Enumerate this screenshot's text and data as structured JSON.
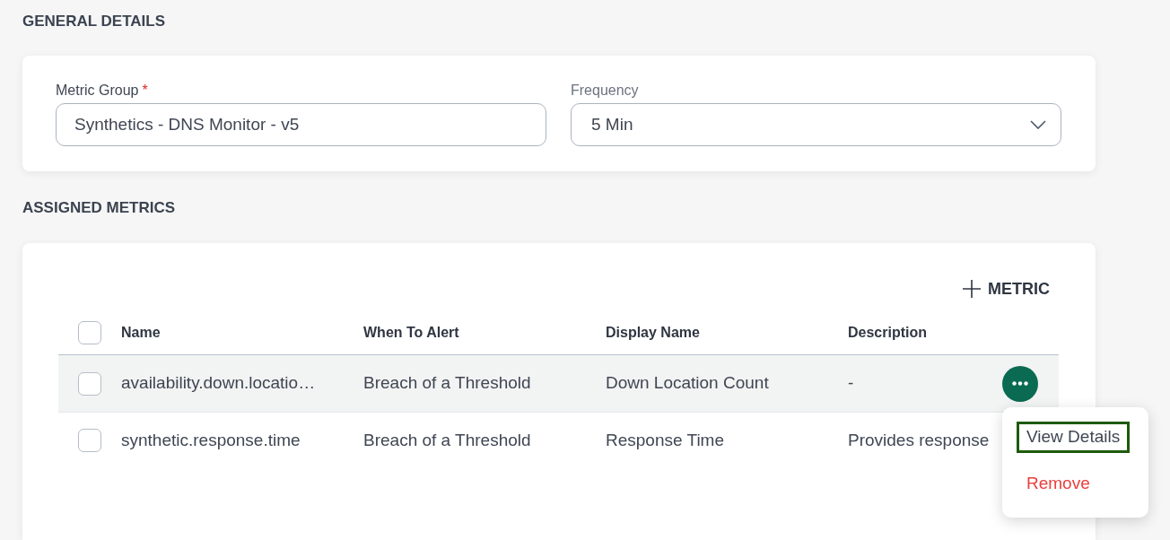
{
  "general_details": {
    "heading": "GENERAL DETAILS",
    "fields": [
      {
        "kind": "text",
        "label": "Metric Group",
        "required_mark": "*",
        "value": "Synthetics - DNS Monitor - v5"
      },
      {
        "kind": "select",
        "label": "Frequency",
        "value": "5 Min"
      }
    ]
  },
  "assigned_metrics": {
    "heading": "ASSIGNED METRICS",
    "add_button": {
      "label": "METRIC"
    },
    "table": {
      "header_checkbox": {
        "checked": false
      },
      "columns": [
        "Name",
        "When To Alert",
        "Display Name",
        "Description"
      ],
      "rows": [
        {
          "checked": false,
          "active": true,
          "cells": [
            "availability.down.locatio…",
            "Breach of a Threshold",
            "Down Location Count",
            "-"
          ]
        },
        {
          "checked": false,
          "active": false,
          "cells": [
            "synthetic.response.time",
            "Breach of a Threshold",
            "Response Time",
            "Provides response"
          ]
        }
      ]
    },
    "row_menu": {
      "items": [
        {
          "label": "View Details",
          "kind": "default",
          "focused": true
        },
        {
          "label": "Remove",
          "kind": "danger",
          "focused": false
        }
      ]
    }
  }
}
